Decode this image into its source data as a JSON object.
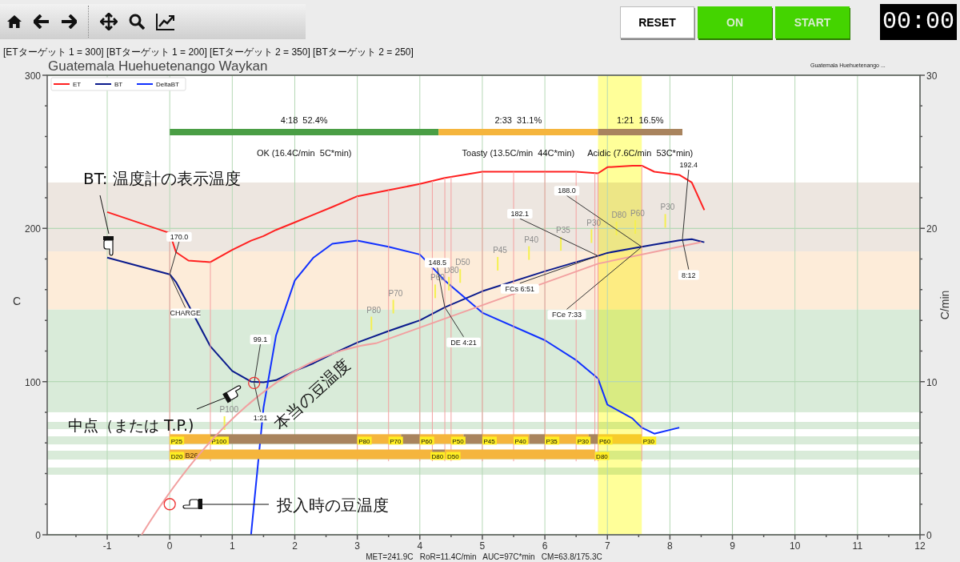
{
  "controls": {
    "buttons": [
      {
        "label": "RESET",
        "kind": "plain"
      },
      {
        "label": "ON",
        "kind": "active"
      },
      {
        "label": "START",
        "kind": "active"
      }
    ],
    "timer": "00:00"
  },
  "targets": "[ETターゲット 1 = 300] [BTターゲット 1 = 200] [ETターゲット 2 = 350] [BTターゲット 2 = 250]",
  "chart": {
    "title": "Guatemala Huehuetenango Waykan",
    "profile_name": "Guatemala Huehuetenango ...",
    "phases": [
      {
        "duration": "4:18  52.4%",
        "label": "OK (16.4C/min  5C*min)",
        "color": "#4a9e45"
      },
      {
        "duration": "2:33  31.1%",
        "label": "Toasty (13.5C/min  44C*min)",
        "color": "#f5b53d"
      },
      {
        "duration": "1:21  16.5%",
        "label": "Acidic (7.6C/min  53C*min)",
        "color": "#a9845e"
      }
    ],
    "bar_rows": [
      {
        "segments": [
          {
            "color": "#f5b53d"
          },
          {
            "color": "#a9845e"
          },
          {
            "color": "#f5b53d"
          },
          {
            "color": "#a9845e"
          },
          {
            "color": "#f5b53d"
          },
          {
            "color": "#a9845e"
          },
          {
            "color": "#f5b53d"
          },
          {
            "color": "#a9845e"
          },
          {
            "color": "#f5b53d"
          },
          {
            "color": "#a9845e"
          },
          {
            "color": "#f7cc2a"
          }
        ],
        "labels": [
          "P25",
          "P100",
          "P80",
          "P70",
          "P60",
          "P50",
          "P45",
          "P40",
          "P35",
          "P30",
          "P60",
          "P30"
        ]
      },
      {
        "segments": [
          {
            "color": "#f5b53d"
          },
          {
            "color": "#a9845e"
          },
          {
            "color": "#f5b53d"
          }
        ],
        "labels": [
          "D20",
          "D80",
          "D50",
          "D80"
        ]
      }
    ],
    "faint_labels": [
      "P100",
      "B26",
      "P80",
      "P70",
      "P60",
      "D80",
      "D50",
      "P45",
      "P40",
      "P35",
      "P30",
      "D80",
      "P60",
      "P30"
    ],
    "markers": [
      {
        "value": "170.0",
        "event": "CHARGE"
      },
      {
        "value": "99.1",
        "event": "1:21"
      },
      {
        "value": "148.5",
        "event": "DE 4:21"
      },
      {
        "value": "182.1",
        "event": "FCs 6:51"
      },
      {
        "value": "188.0",
        "event": "FCe 7:33"
      },
      {
        "value": "192.4",
        "event": "8:12"
      }
    ],
    "notes": [
      {
        "kind": "bt",
        "text": "BT: 温度計の表示温度"
      },
      {
        "kind": "tp",
        "text": "中点（または T.P.)"
      },
      {
        "kind": "bean",
        "text": "本当の豆温度"
      },
      {
        "kind": "charge",
        "text": "投入時の豆温度"
      }
    ],
    "status": "MET=241.9C   RoR=11.4C/min   AUC=97C*min   CM=63.8/175.3C",
    "chart_data": {
      "type": "line",
      "ylabel": "C",
      "y2label": "C/min",
      "xlim": [
        -1.96,
        12
      ],
      "ylim": [
        0,
        300
      ],
      "y2lim": [
        0,
        30
      ],
      "xticks": [
        -1,
        0,
        1,
        2,
        3,
        4,
        5,
        6,
        7,
        8,
        9,
        10,
        11,
        12
      ],
      "yticks": [
        0,
        100,
        200,
        300
      ],
      "y2ticks": [
        0,
        10,
        20,
        30
      ],
      "grid": true,
      "legend": true,
      "bands": [
        {
          "axis": "y",
          "from": 185,
          "to": 230,
          "color": "#ede6e0"
        },
        {
          "axis": "y",
          "from": 147,
          "to": 185,
          "color": "#fdecd9"
        },
        {
          "axis": "y",
          "from": 80,
          "to": 147,
          "color": "#d9ebd9"
        },
        {
          "axis": "y",
          "from": 69,
          "to": 73.7,
          "color": "#d9ebd9"
        },
        {
          "axis": "y",
          "from": 59,
          "to": 64.3,
          "color": "#d9ebd9"
        },
        {
          "axis": "y",
          "from": 49.1,
          "to": 54.9,
          "color": "#d9ebd9"
        },
        {
          "axis": "y",
          "from": 39.2,
          "to": 43.9,
          "color": "#d9ebd9"
        },
        {
          "axis": "x",
          "from": 6.85,
          "to": 7.55,
          "color": "#ffff99"
        }
      ],
      "x": [
        -1,
        0,
        0.1,
        0.3,
        0.65,
        1,
        1.3,
        1.5,
        1.7,
        2,
        2.3,
        2.6,
        3,
        3.5,
        4,
        4.4,
        5,
        6,
        6.5,
        6.85,
        7,
        7.4,
        7.55,
        7.75,
        8.15,
        8.35,
        8.55
      ],
      "series": [
        {
          "name": "ET",
          "color": "#ff2020",
          "values": [
            210.7,
            197,
            184.5,
            179,
            178,
            186,
            192,
            195,
            199,
            204,
            209,
            214,
            221,
            225,
            229,
            233,
            237,
            237,
            237,
            236,
            240,
            241,
            241,
            237,
            235,
            230,
            212
          ]
        },
        {
          "name": "BT",
          "color": "#0a1a8c",
          "values": [
            181,
            170,
            165,
            150,
            123,
            107,
            100,
            99.5,
            101,
            107,
            112,
            118,
            125.5,
            133,
            140,
            148.5,
            159,
            172,
            178,
            182.1,
            184,
            187,
            188,
            189.5,
            192.2,
            193,
            191
          ]
        },
        {
          "name": "DeltaBT",
          "color": "#1030ff",
          "axis": "y2",
          "values": [
            null,
            null,
            null,
            null,
            null,
            null,
            0,
            8.3,
            13,
            16.6,
            18.1,
            19,
            19.2,
            18.8,
            18.3,
            16.6,
            14.5,
            12.7,
            11.4,
            10.2,
            8.5,
            7.6,
            7,
            6.6,
            7,
            null,
            null
          ]
        }
      ]
    }
  }
}
